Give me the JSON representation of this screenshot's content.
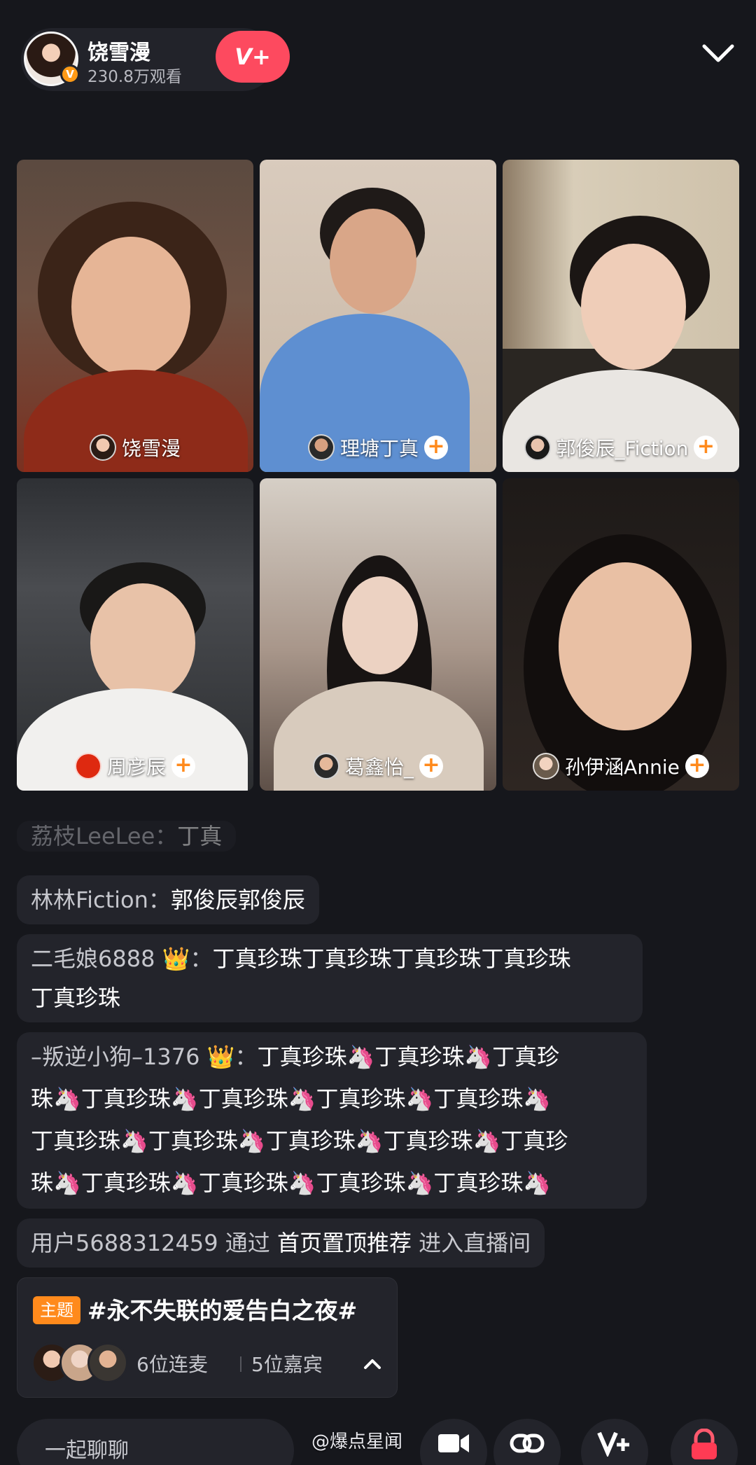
{
  "host": {
    "name": "饶雪漫",
    "views": "230.8万观看",
    "vip_label": "V+",
    "verify_mark": "V"
  },
  "tiles": [
    {
      "name": "饶雪漫",
      "plus": false,
      "bg": "#7a4b36"
    },
    {
      "name": "理塘丁真",
      "plus": true,
      "plus_label": "+",
      "bg": "#c9b8a6"
    },
    {
      "name": "郭俊辰_Fiction",
      "plus": true,
      "plus_label": "+",
      "bg": "#b9a892"
    },
    {
      "name": "周彦辰",
      "plus": true,
      "plus_label": "+",
      "bg": "#3a3c40"
    },
    {
      "name": "葛鑫怡_",
      "plus": true,
      "plus_label": "+",
      "bg": "#8b7a68"
    },
    {
      "name": "孙伊涵Annie",
      "plus": true,
      "plus_label": "+",
      "bg": "#2a2420"
    }
  ],
  "comments": [
    {
      "user": "荔枝LeeLee：",
      "text": "丁真"
    },
    {
      "user": "林林Fiction：",
      "text": "郭俊辰郭俊辰"
    },
    {
      "user": "二毛娘6888 👑：",
      "text": "丁真珍珠丁真珍珠丁真珍珠丁真珍珠",
      "text2": "丁真珍珠"
    },
    {
      "user": "–叛逆小狗–1376 👑：",
      "line1": "丁真珍珠🦄丁真珍珠🦄丁真珍",
      "line2": "珠🦄丁真珍珠🦄丁真珍珠🦄丁真珍珠🦄丁真珍珠🦄",
      "line3": "丁真珍珠🦄丁真珍珠🦄丁真珍珠🦄丁真珍珠🦄丁真珍",
      "line4": "珠🦄丁真珍珠🦄丁真珍珠🦄丁真珍珠🦄丁真珍珠🦄"
    },
    {
      "user": "用户5688312459",
      "via": "通过",
      "source": "首页置顶推荐",
      "action": "进入直播间"
    }
  ],
  "topic": {
    "tag": "主题",
    "title": "#永不失联的爱告白之夜#",
    "mics": "6位连麦",
    "guests": "5位嘉宾"
  },
  "bottom": {
    "chat_placeholder": "一起聊聊",
    "watermark": "@爆点星闻"
  },
  "colors": {
    "accent": "#fd4a5f",
    "orange": "#ff8a1c",
    "background": "#16171c",
    "bubble": "#23242b"
  }
}
